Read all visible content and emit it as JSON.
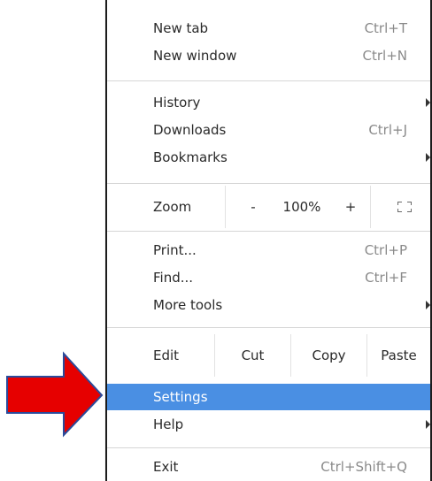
{
  "menu": {
    "new_tab": {
      "label": "New tab",
      "shortcut": "Ctrl+T"
    },
    "new_window": {
      "label": "New window",
      "shortcut": "Ctrl+N"
    },
    "history": {
      "label": "History"
    },
    "downloads": {
      "label": "Downloads",
      "shortcut": "Ctrl+J"
    },
    "bookmarks": {
      "label": "Bookmarks"
    },
    "zoom": {
      "label": "Zoom",
      "minus": "-",
      "level": "100%",
      "plus": "+"
    },
    "print": {
      "label": "Print...",
      "shortcut": "Ctrl+P"
    },
    "find": {
      "label": "Find...",
      "shortcut": "Ctrl+F"
    },
    "more_tools": {
      "label": "More tools"
    },
    "edit": {
      "label": "Edit",
      "cut": "Cut",
      "copy": "Copy",
      "paste": "Paste"
    },
    "settings": {
      "label": "Settings"
    },
    "help": {
      "label": "Help"
    },
    "exit": {
      "label": "Exit",
      "shortcut": "Ctrl+Shift+Q"
    }
  },
  "colors": {
    "selected_bg": "#4a8fe3",
    "pointer_arrow_fill": "#e60000",
    "pointer_arrow_stroke": "#2a4a9a"
  },
  "icons": {
    "submenu": "caret-right-icon",
    "fullscreen": "fullscreen-icon",
    "pointer": "red-arrow-pointer"
  }
}
